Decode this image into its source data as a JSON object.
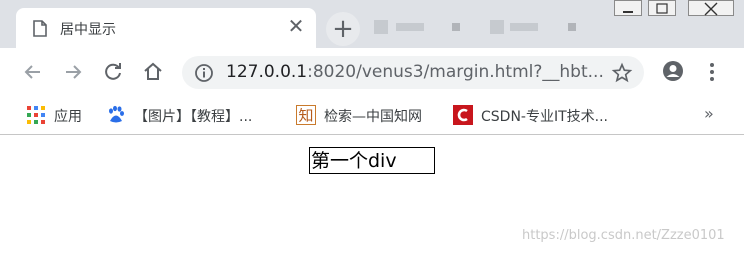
{
  "tab": {
    "title": "居中显示",
    "close_glyph": "✕"
  },
  "new_tab_glyph": "+",
  "address": {
    "host": "127.0.0.1",
    "rest": ":8020/venus3/margin.html?__hbt..."
  },
  "bookmarks": {
    "items": [
      {
        "label": "应用",
        "icon": "apps-grid-icon"
      },
      {
        "label": "【图片】【教程】...",
        "icon": "baidu-paw-icon"
      },
      {
        "label": "检索—中国知网",
        "icon": "cnki-zhi-icon"
      },
      {
        "label": "CSDN-专业IT技术...",
        "icon": "csdn-c-icon"
      }
    ],
    "more_glyph": "»"
  },
  "page": {
    "div_text": "第一个div"
  },
  "watermark": "https://blog.csdn.net/Zzze0101"
}
